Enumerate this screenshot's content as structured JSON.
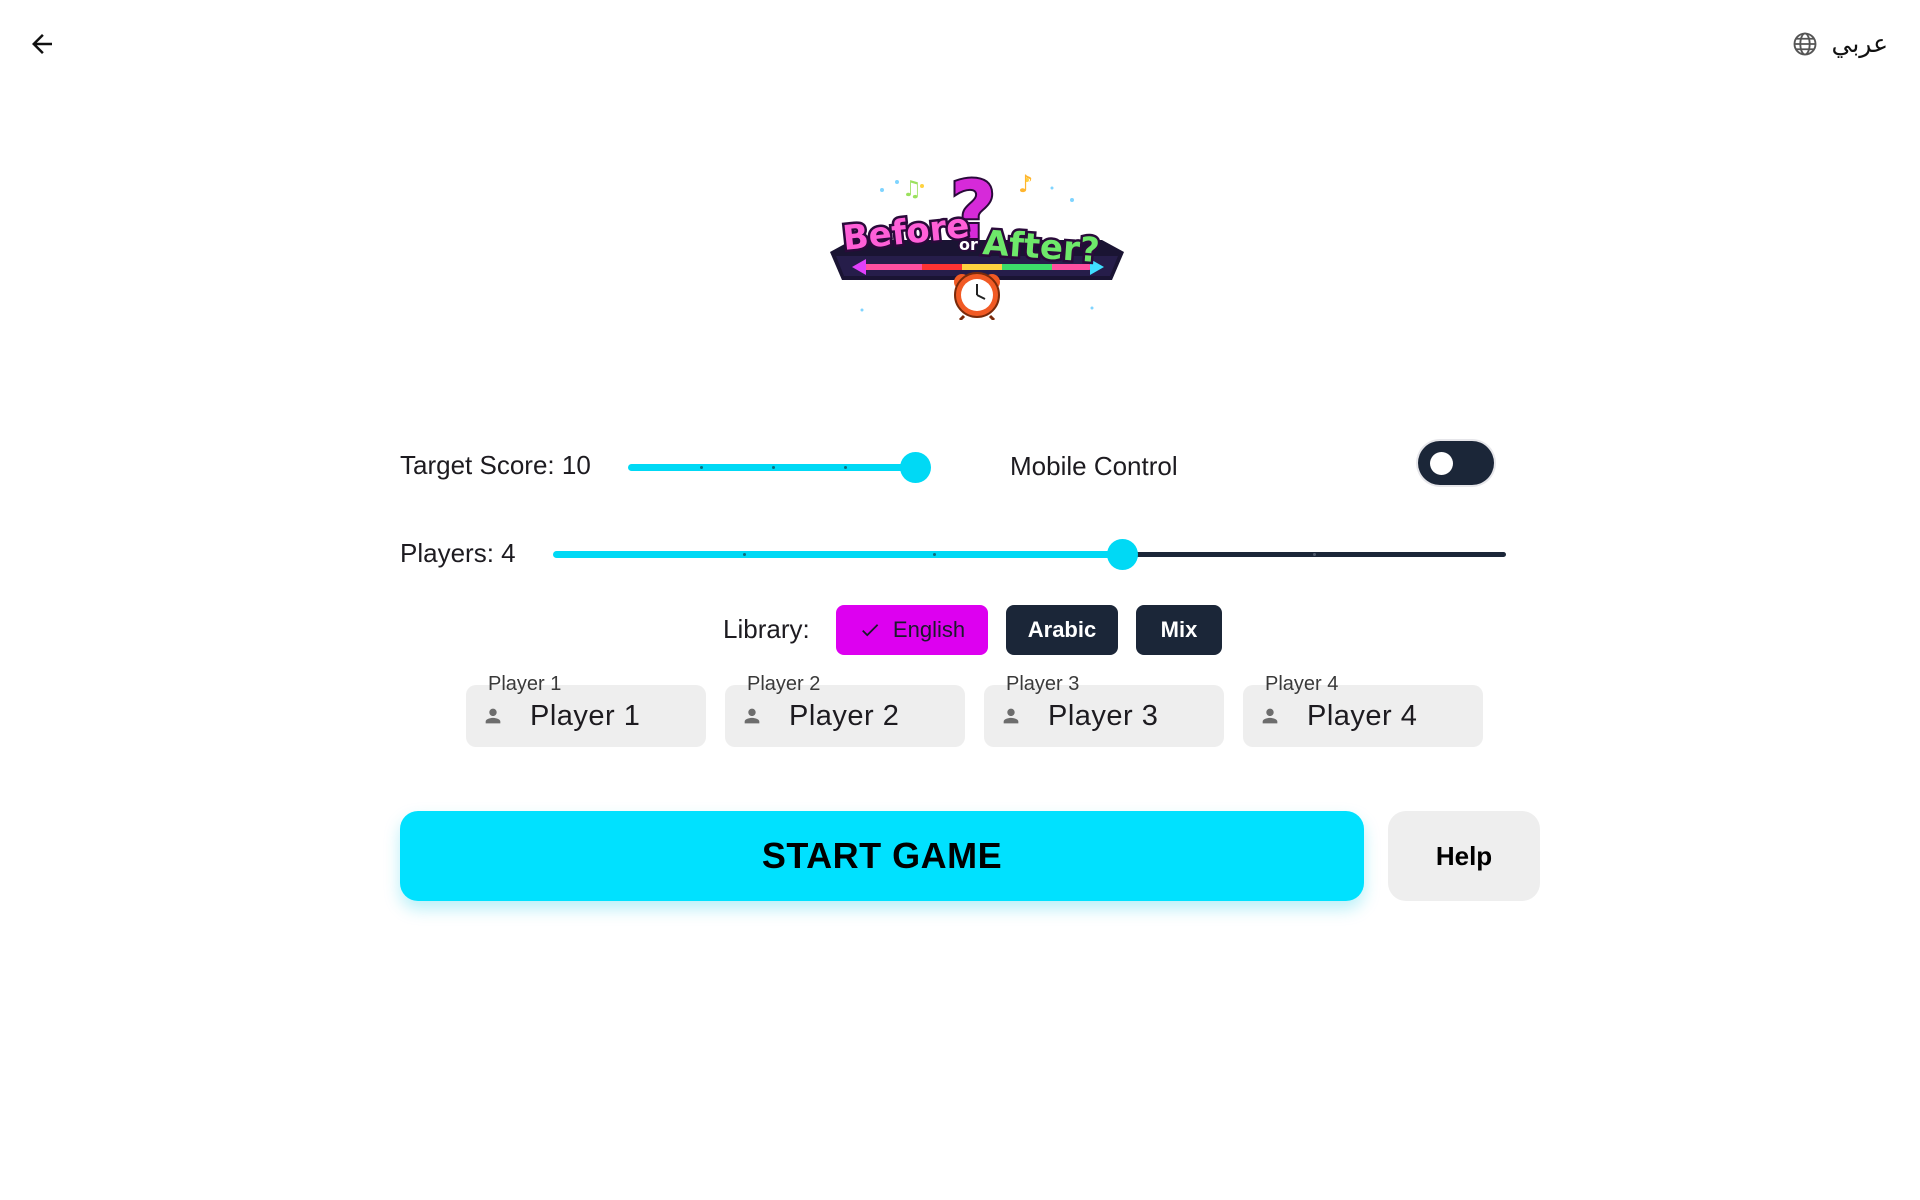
{
  "topbar": {
    "back_icon": "arrow-left-icon",
    "language_label": "عربي",
    "language_icon": "globe-icon"
  },
  "logo": {
    "line1": "Before",
    "line2": "or",
    "line3": "After?",
    "mark": "?"
  },
  "settings": {
    "target_score_label": "Target Score: 10",
    "target_score": {
      "value": 10,
      "fraction": 1.0
    },
    "mobile_control_label": "Mobile Control",
    "mobile_control_on": false,
    "players_label": "Players: 4",
    "players": {
      "value": 4,
      "fraction": 0.6
    }
  },
  "library": {
    "label": "Library:",
    "options": [
      {
        "label": "English",
        "selected": true
      },
      {
        "label": "Arabic",
        "selected": false
      },
      {
        "label": "Mix",
        "selected": false
      }
    ]
  },
  "players_fields": [
    {
      "label": "Player 1",
      "value": "Player 1"
    },
    {
      "label": "Player 2",
      "value": "Player 2"
    },
    {
      "label": "Player 3",
      "value": "Player 3"
    },
    {
      "label": "Player 4",
      "value": "Player 4"
    }
  ],
  "actions": {
    "start_label": "START GAME",
    "help_label": "Help"
  },
  "colors": {
    "accent": "#00e1ff",
    "selected_chip": "#dd00f0",
    "dark": "#1b2638"
  }
}
